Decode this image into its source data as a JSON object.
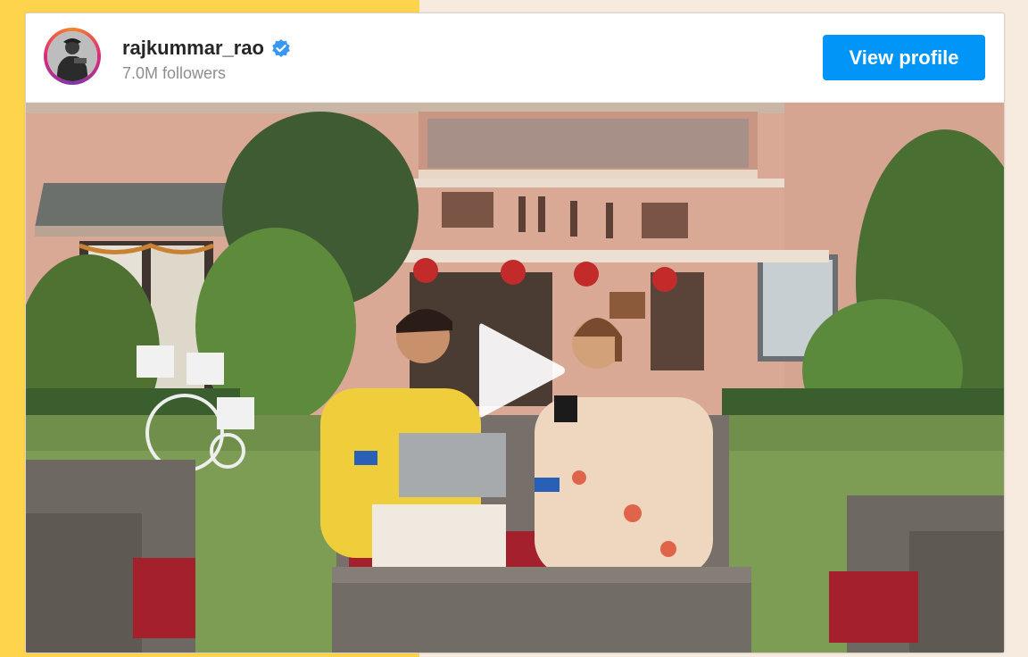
{
  "profile": {
    "username": "rajkummar_rao",
    "verified": true,
    "followers": "7.0M followers",
    "view_profile_label": "View profile"
  },
  "media": {
    "type": "video",
    "play_icon": "play-icon"
  },
  "colors": {
    "accent": "#0095f6",
    "page_background": "#f7ebe0",
    "left_band": "#fdd44b",
    "verified_badge": "#3897f0"
  }
}
